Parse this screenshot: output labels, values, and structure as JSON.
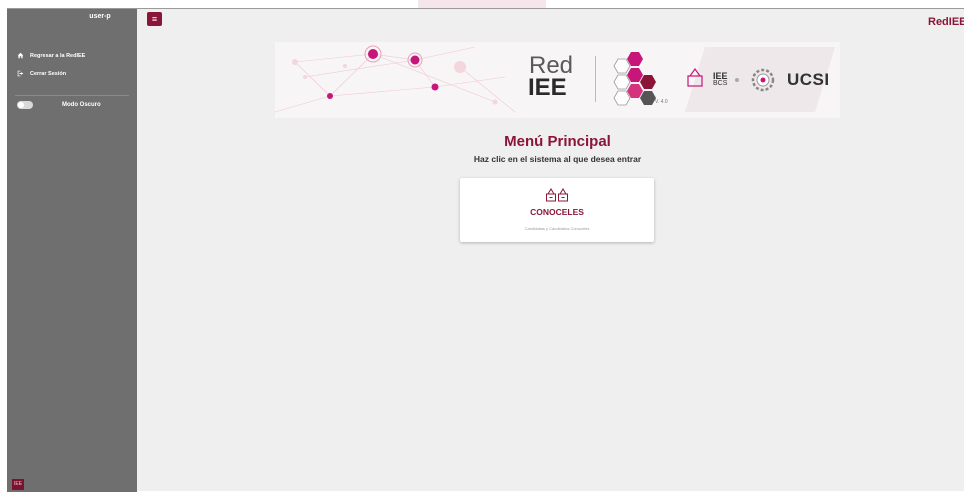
{
  "sidebar": {
    "user": "user-p",
    "items": [
      {
        "icon": "home-icon",
        "label": "Regresar a la RedIEE"
      },
      {
        "icon": "logout-icon",
        "label": "Cerrar Sesión"
      }
    ],
    "dark_mode_label": "Modo Oscuro",
    "dark_mode_on": false,
    "corner_badge": "IEE"
  },
  "header": {
    "menu_icon": "hamburger-menu-icon",
    "brand": "RedIEE"
  },
  "banner": {
    "red": "Red",
    "iee": "IEE",
    "version": "V. 4.0",
    "iee_bcs_top": "IEE",
    "iee_bcs_bottom": "BCS",
    "ucsi": "UCSI"
  },
  "main": {
    "title": "Menú Principal",
    "subtitle": "Haz clic en el sistema al que desea entrar",
    "cards": [
      {
        "icon": "ballot-box-icon",
        "title": "CONOCELES",
        "description": "Candidatas y Candidatos Conoceles"
      }
    ]
  },
  "colors": {
    "accent": "#8b1538",
    "sidebar": "#6f6f6f",
    "background": "#efefef"
  }
}
